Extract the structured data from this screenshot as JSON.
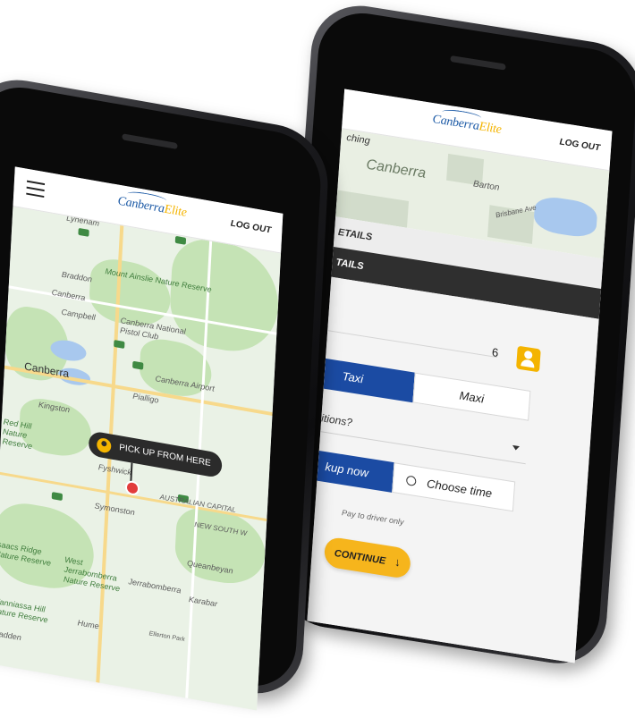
{
  "brand": {
    "logo_main": "Canberra",
    "logo_accent": "Elite"
  },
  "header": {
    "logout_label": "LOG OUT"
  },
  "map": {
    "labels": [
      "Lyneham",
      "Mount Ainslie Nature Reserve",
      "Braddon",
      "Canberra",
      "Campbell",
      "Canberra National Pistol Club",
      "Canberra Airport",
      "Pialligo",
      "Canberra",
      "Kingston",
      "Fyshwick",
      "Red Hill Nature Reserve",
      "AUSTRALIAN CAPITAL",
      "Symonston",
      "NEW SOUTH W",
      "Queanbeyan",
      "Isaacs Ridge Nature Reserve",
      "West Jerrabomberra Nature Reserve",
      "Jerrabomberra",
      "Karabar",
      "Wanniassa Hill Nature Reserve",
      "Hume",
      "Fadden",
      "Ellerton Park"
    ],
    "pickup_label": "PICK UP FROM HERE"
  },
  "booking": {
    "map_searching": "ching",
    "map_city": "Canberra",
    "map_suburb": "Barton",
    "map_street": "Brisbane Ave",
    "section_details_1": "ETAILS",
    "section_details_2": "TAILS",
    "passengers": "6",
    "vehicle_options": [
      "Taxi",
      "Maxi"
    ],
    "selected_vehicle": "Taxi",
    "conditions_label": "itions?",
    "pickup_now_label": "kup now",
    "choose_time_label": "Choose time",
    "payment_note": "Pay to driver only",
    "continue_label": "CONTINUE"
  },
  "colors": {
    "brand_blue": "#1b4ba3",
    "brand_yellow": "#f6b51c",
    "dark_bar": "#2f2f2f"
  },
  "icons": [
    "hamburger-menu-icon",
    "location-pin-icon",
    "add-passenger-icon",
    "clock-icon",
    "arrow-down-icon",
    "dropdown-caret-icon"
  ]
}
